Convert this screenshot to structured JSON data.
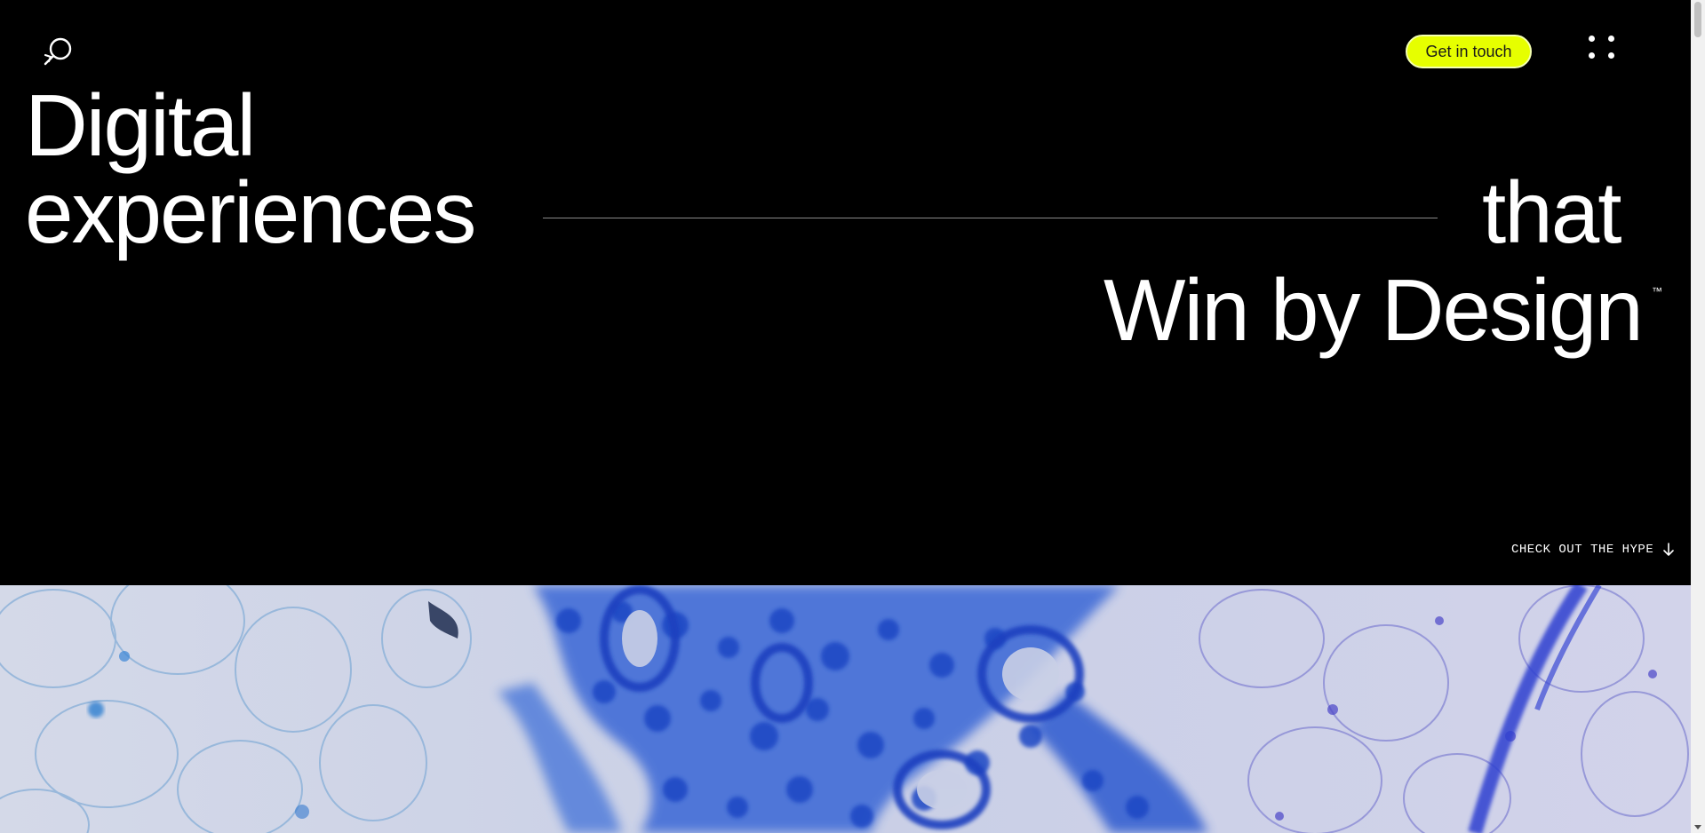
{
  "header": {
    "logo_icon": "magnifier-star-logo-icon",
    "cta_label": "Get in touch",
    "menu_icon": "four-dots-menu-icon"
  },
  "hero": {
    "line1": "Digital",
    "line2_left": "experiences",
    "line2_right": "that",
    "line3": "Win by Design",
    "trademark": "™"
  },
  "scroll_cue": {
    "label": "CHECK OUT THE HYPE",
    "icon": "arrow-down-icon"
  },
  "media": {
    "description_icon": "microscopy-tissue-image"
  },
  "colors": {
    "background": "#000000",
    "accent": "#e6ff00",
    "text": "#ffffff",
    "tissue_blue": "#2a56d4",
    "tissue_background": "#cfd3e6"
  }
}
